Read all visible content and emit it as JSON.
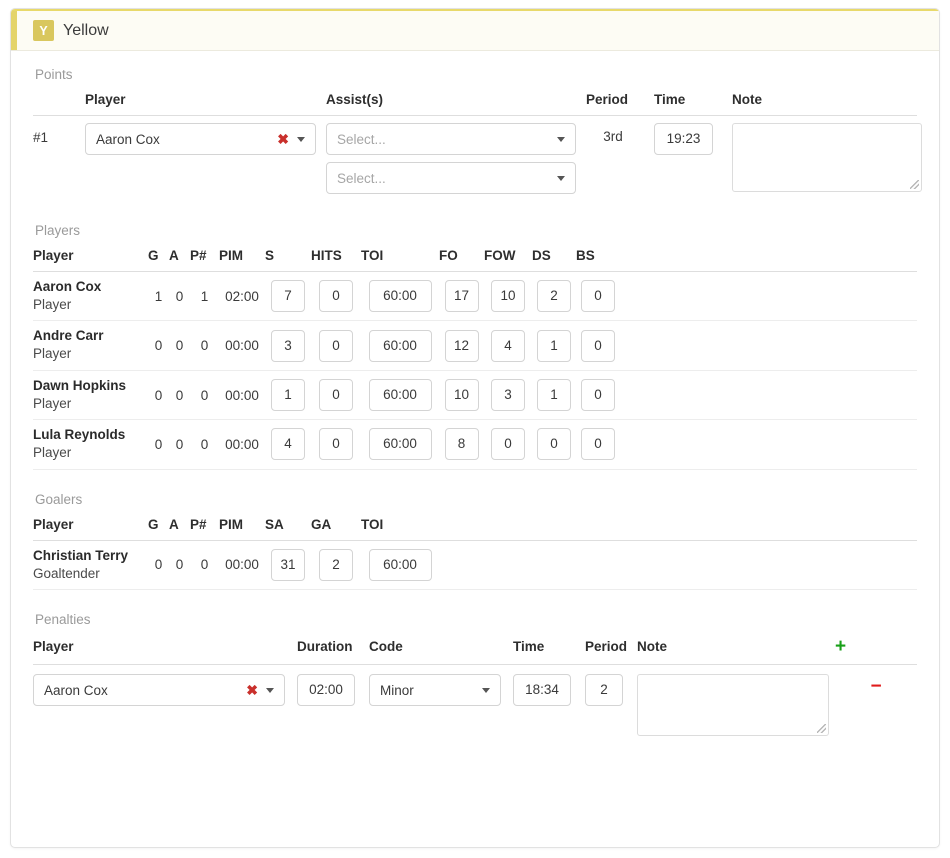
{
  "header": {
    "badge_letter": "Y",
    "team_name": "Yellow",
    "accent_color": "#e4d46a"
  },
  "points": {
    "title": "Points",
    "columns": {
      "player": "Player",
      "assists": "Assist(s)",
      "period": "Period",
      "time": "Time",
      "note": "Note"
    },
    "rows": [
      {
        "index": "#1",
        "player": "Aaron Cox",
        "clear_icon": "clear-x-icon",
        "assist1_placeholder": "Select...",
        "assist2_placeholder": "Select...",
        "period": "3rd",
        "time": "19:23",
        "note": ""
      }
    ]
  },
  "players": {
    "title": "Players",
    "columns": [
      "Player",
      "G",
      "A",
      "P#",
      "PIM",
      "S",
      "HITS",
      "TOI",
      "FO",
      "FOW",
      "DS",
      "BS"
    ],
    "rows": [
      {
        "name": "Aaron Cox",
        "role": "Player",
        "g": "1",
        "a": "0",
        "pnum": "1",
        "pim": "02:00",
        "s": "7",
        "hits": "0",
        "toi": "60:00",
        "fo": "17",
        "fow": "10",
        "ds": "2",
        "bs": "0"
      },
      {
        "name": "Andre Carr",
        "role": "Player",
        "g": "0",
        "a": "0",
        "pnum": "0",
        "pim": "00:00",
        "s": "3",
        "hits": "0",
        "toi": "60:00",
        "fo": "12",
        "fow": "4",
        "ds": "1",
        "bs": "0"
      },
      {
        "name": "Dawn Hopkins",
        "role": "Player",
        "g": "0",
        "a": "0",
        "pnum": "0",
        "pim": "00:00",
        "s": "1",
        "hits": "0",
        "toi": "60:00",
        "fo": "10",
        "fow": "3",
        "ds": "1",
        "bs": "0"
      },
      {
        "name": "Lula Reynolds",
        "role": "Player",
        "g": "0",
        "a": "0",
        "pnum": "0",
        "pim": "00:00",
        "s": "4",
        "hits": "0",
        "toi": "60:00",
        "fo": "8",
        "fow": "0",
        "ds": "0",
        "bs": "0"
      }
    ]
  },
  "goalers": {
    "title": "Goalers",
    "columns": [
      "Player",
      "G",
      "A",
      "P#",
      "PIM",
      "SA",
      "GA",
      "TOI"
    ],
    "rows": [
      {
        "name": "Christian Terry",
        "role": "Goaltender",
        "g": "0",
        "a": "0",
        "pnum": "0",
        "pim": "00:00",
        "sa": "31",
        "ga": "2",
        "toi": "60:00"
      }
    ]
  },
  "penalties": {
    "title": "Penalties",
    "columns": {
      "player": "Player",
      "duration": "Duration",
      "code": "Code",
      "time": "Time",
      "period": "Period",
      "note": "Note"
    },
    "add_label": "+",
    "remove_label": "−",
    "rows": [
      {
        "player": "Aaron Cox",
        "clear_icon": "clear-x-icon",
        "duration": "02:00",
        "code": "Minor",
        "time": "18:34",
        "period": "2",
        "note": ""
      }
    ]
  }
}
